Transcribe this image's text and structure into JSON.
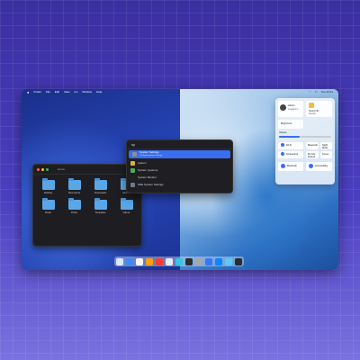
{
  "menubar": {
    "apple": "",
    "items": [
      "Finder",
      "File",
      "Edit",
      "View",
      "Go",
      "Window",
      "Help"
    ],
    "clock": "Tue 10:41"
  },
  "finder": {
    "path": "Home",
    "folders": [
      {
        "label": "Desktop"
      },
      {
        "label": "Documents"
      },
      {
        "label": "Downloads"
      },
      {
        "label": "Movies"
      },
      {
        "label": "Music"
      },
      {
        "label": "Public"
      },
      {
        "label": "Templates"
      },
      {
        "label": "Videos"
      }
    ]
  },
  "launcher": {
    "query": "sy",
    "results": [
      {
        "label": "System Settings",
        "sub": "Configure system settings",
        "color": "#8e8e93"
      },
      {
        "label": "system",
        "sub": "",
        "color": "#e0b13a"
      },
      {
        "label": "System (system)",
        "sub": "",
        "color": "#4caf50"
      },
      {
        "label": "System Monitor",
        "sub": "",
        "color": "#222222"
      },
      {
        "label": "KDE System Settings",
        "sub": "",
        "color": "#6c7a89"
      }
    ]
  },
  "control_center": {
    "user": "Adrien",
    "user_sub": "Logged in",
    "now_playing": "Sound 40",
    "now_playing_sub": "Spotify",
    "brightness_label": "Brightness",
    "volume_label": "Volume",
    "tiles": [
      {
        "label": "Wi-Fi"
      },
      {
        "label": "Bluetooth"
      },
      {
        "label": "Night Mode"
      },
      {
        "label": "Screenshot"
      },
      {
        "label": "Do Not Disturb"
      },
      {
        "label": "Focus"
      }
    ],
    "bottom": [
      {
        "label": "Bluetooth"
      },
      {
        "label": "Accessibility"
      }
    ]
  },
  "dock": {
    "apps": [
      {
        "name": "finder",
        "color": "#d9e8ff"
      },
      {
        "name": "safari",
        "color": "#3d8af7"
      },
      {
        "name": "notes",
        "color": "#f5f5f5"
      },
      {
        "name": "photos",
        "color": "#ff9f0a"
      },
      {
        "name": "maps",
        "color": "#ff3b30"
      },
      {
        "name": "terminal",
        "color": "#e8ecf2"
      },
      {
        "name": "vscode",
        "color": "#34c7e0"
      },
      {
        "name": "obsidian",
        "color": "#2c2c2e"
      },
      {
        "name": "xcode",
        "color": "#a6a6ad"
      },
      {
        "name": "appstore",
        "color": "#3478f6"
      },
      {
        "name": "music",
        "color": "#0a84ff"
      },
      {
        "name": "settings",
        "color": "#5ac8fa"
      },
      {
        "name": "launchpad",
        "color": "#2b2b2b"
      }
    ]
  }
}
